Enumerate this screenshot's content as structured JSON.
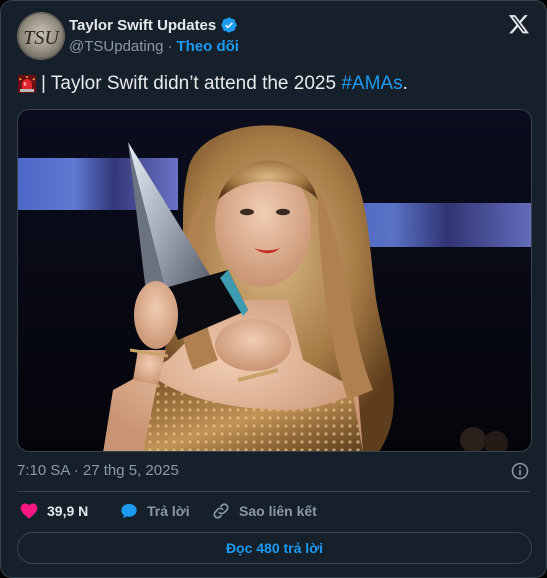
{
  "author": {
    "display_name": "Taylor Swift Updates",
    "handle": "@TSUpdating",
    "separator": "·",
    "follow_label": "Theo dõi",
    "avatar_text": "TSU",
    "verified": true
  },
  "tweet": {
    "siren_emoji": "siren-icon",
    "text_prefix": "| Taylor Swift didn’t attend the 2025 ",
    "hashtag": "#AMAs",
    "text_suffix": ".",
    "photo_alt": "Taylor Swift holding an award"
  },
  "meta": {
    "timestamp": "7:10 SA · 27 thg 5, 2025"
  },
  "actions": {
    "likes": "39,9 N",
    "reply_label": "Trả lời",
    "copy_link_label": "Sao liên kết"
  },
  "read_replies": {
    "label": "Đọc 480 trả lời"
  },
  "colors": {
    "background": "#15202b",
    "accent": "#1d9bf0",
    "like": "#f91880",
    "muted": "#8b98a5",
    "text": "#e7e9ea"
  }
}
